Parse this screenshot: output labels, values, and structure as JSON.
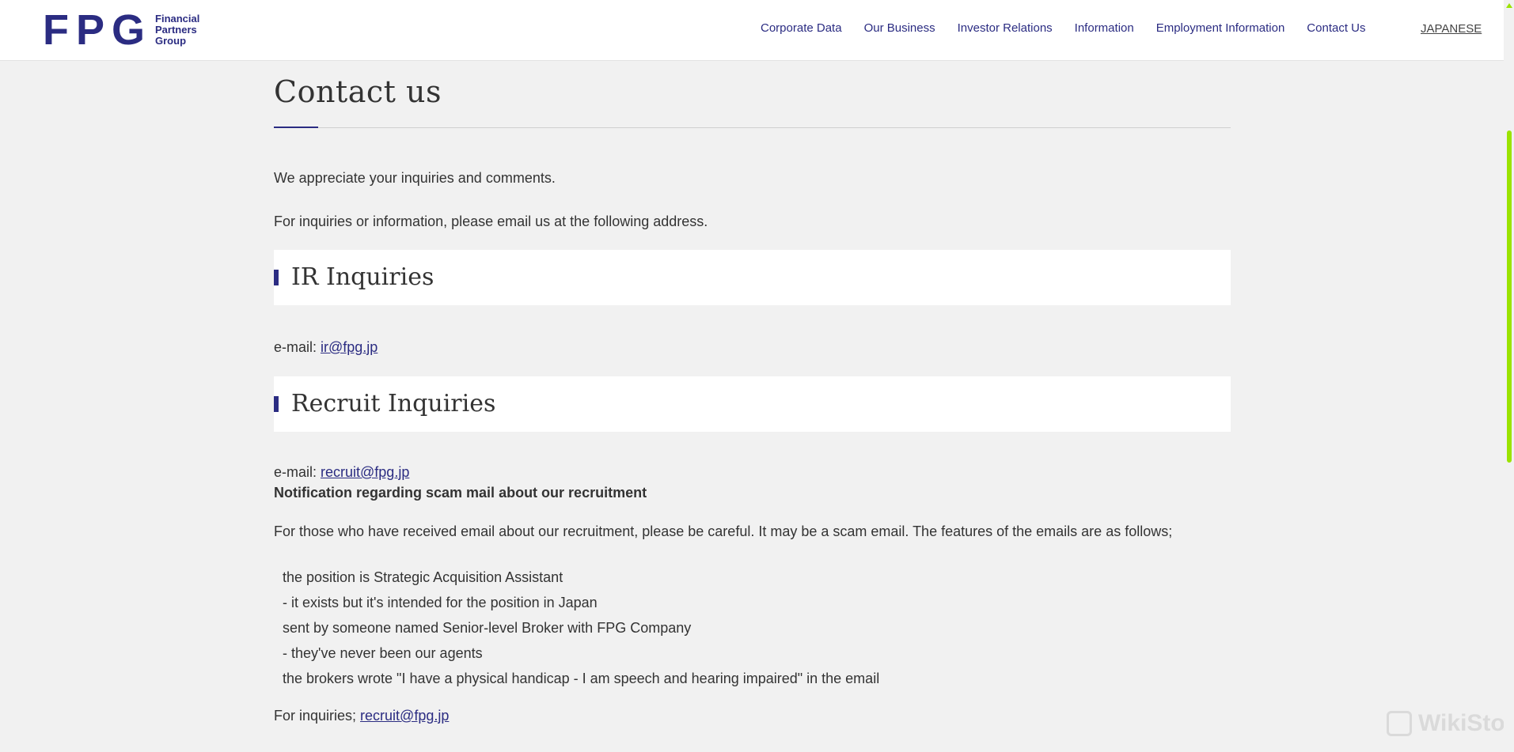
{
  "header": {
    "logo": {
      "mark": "FPG",
      "line1": "Financial",
      "line2": "Partners",
      "line3": "Group"
    },
    "nav": [
      {
        "label": "Corporate Data"
      },
      {
        "label": "Our Business"
      },
      {
        "label": "Investor Relations"
      },
      {
        "label": "Information"
      },
      {
        "label": "Employment Information"
      },
      {
        "label": "Contact Us"
      }
    ],
    "language": "JAPANESE"
  },
  "main": {
    "title": "Contact us",
    "intro1": "We appreciate your inquiries and comments.",
    "intro2": "For inquiries or information, please email us at the following address.",
    "ir": {
      "heading": "IR Inquiries",
      "email_label": "e-mail: ",
      "email": "ir@fpg.jp"
    },
    "recruit": {
      "heading": "Recruit Inquiries",
      "email_label": "e-mail: ",
      "email": "recruit@fpg.jp",
      "notice_title": "Notification regarding scam mail about our recruitment",
      "notice_text": "For those who have received email about our recruitment, please be careful. It may be a scam email. The features of the emails are as follows;",
      "features": [
        "the position is Strategic Acquisition Assistant",
        "- it exists but it's intended for the position in Japan",
        "sent by someone named Senior-level Broker with FPG Company",
        "- they've never been our agents",
        "the brokers wrote \"I have a physical handicap - I am speech and hearing impaired\" in the email"
      ],
      "final_label": "For inquiries; ",
      "final_email": "recruit@fpg.jp"
    }
  },
  "watermark": "WikiStock",
  "colors": {
    "brand": "#2b2c82",
    "background": "#f1f1f1",
    "scroll_thumb": "#9be300"
  }
}
